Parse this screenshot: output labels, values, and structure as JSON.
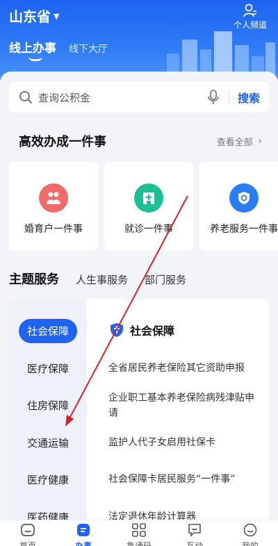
{
  "header": {
    "region": "山东省",
    "personal_label": "个人频道",
    "tab_online": "线上办事",
    "tab_offline": "线下大厅"
  },
  "search": {
    "placeholder": "查询公积金",
    "button": "搜索"
  },
  "efficient": {
    "title": "高效办成一件事",
    "see_all": "查看全部",
    "cards": [
      {
        "label": "婚育户一件事",
        "icon": "family-icon",
        "color": "#f06a6a"
      },
      {
        "label": "就诊一件事",
        "icon": "hospital-icon",
        "color": "#1fbf95"
      },
      {
        "label": "养老服务一件事",
        "icon": "elder-care-icon",
        "color": "#2c7cf2"
      }
    ]
  },
  "theme_tabs": [
    "主题服务",
    "人生事服务",
    "部门服务"
  ],
  "categories": [
    "社会保障",
    "医疗保障",
    "住房保障",
    "交通运输",
    "医疗健康",
    "医药健康"
  ],
  "selected_category": "社会保障",
  "service_list": [
    "全省居民养老保险其它资助申报",
    "企业职工基本养老保险病残津贴申请",
    "监护人代子女启用社保卡",
    "社会保障卡居民服务“一件事”",
    "法定退休年龄计算器"
  ],
  "bottom_nav": [
    {
      "label": "首页",
      "icon": "home-icon"
    },
    {
      "label": "办事",
      "icon": "service-icon"
    },
    {
      "label": "鲁通码",
      "icon": "qr-code-icon"
    },
    {
      "label": "互动",
      "icon": "chat-icon"
    },
    {
      "label": "我的",
      "icon": "profile-icon"
    }
  ],
  "colors": {
    "accent": "#1f63ee",
    "annotation": "#d6202a"
  }
}
